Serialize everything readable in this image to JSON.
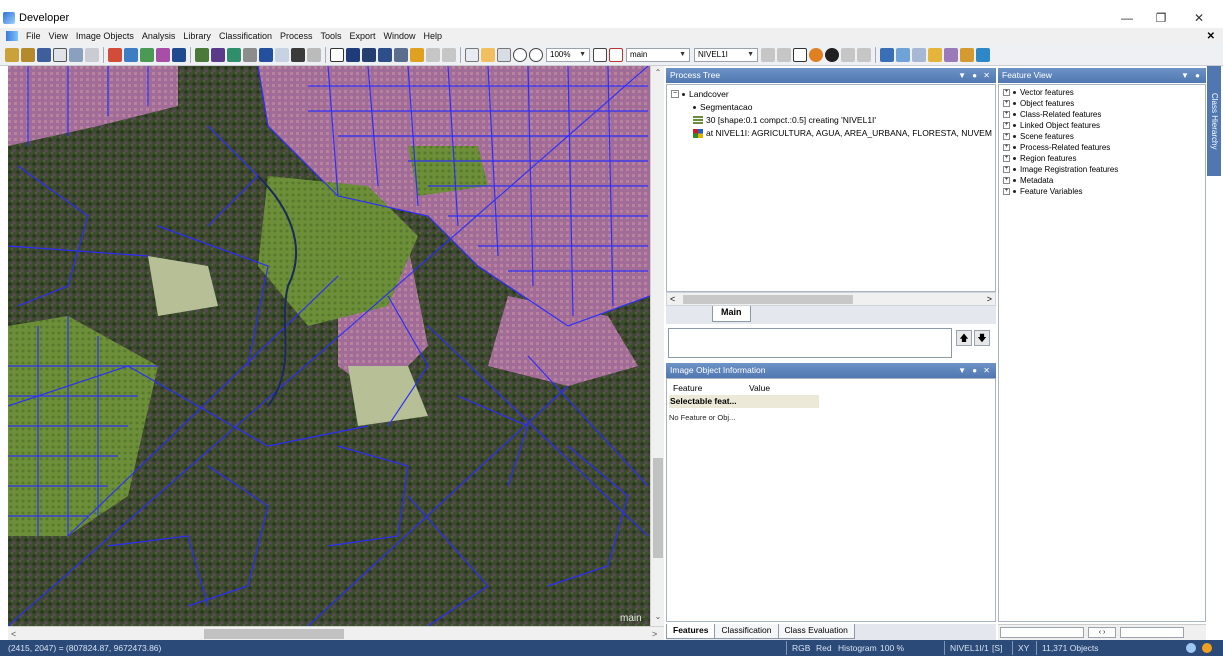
{
  "window": {
    "title": "Developer"
  },
  "menu": [
    "File",
    "View",
    "Image Objects",
    "Analysis",
    "Library",
    "Classification",
    "Process",
    "Tools",
    "Export",
    "Window",
    "Help"
  ],
  "toolbar": {
    "zoom": "100%",
    "view_combo": "main",
    "level_combo": "NIVEL1I"
  },
  "viewer": {
    "label": "main"
  },
  "process_tree": {
    "title": "Process Tree",
    "rows": [
      "Landcover",
      "Segmentacao",
      "30 [shape:0.1 compct.:0.5] creating 'NIVEL1I'",
      "at  NIVEL1I: AGRICULTURA, AGUA, AREA_URBANA, FLORESTA, NUVEM"
    ],
    "tab": "Main"
  },
  "image_object_info": {
    "title": "Image Object Information",
    "col_feature": "Feature",
    "col_value": "Value",
    "selected": "Selectable feat...",
    "empty": "No Feature or Obj..."
  },
  "bottom_tabs": [
    "Features",
    "Classification",
    "Class Evaluation"
  ],
  "feature_view": {
    "title": "Feature View",
    "items": [
      "Vector features",
      "Object features",
      "Class-Related features",
      "Linked Object features",
      "Scene features",
      "Process-Related features",
      "Region features",
      "Image Registration features",
      "Metadata",
      "Feature Variables"
    ]
  },
  "side_tab": "Class Hierarchy",
  "status": {
    "coords": "(2415, 2047) = (807824.87, 9672473.86)",
    "rgb": "RGB",
    "red": "Red",
    "histogram": "Histogram",
    "zoom": "100 %",
    "level": "NIVEL1I/1",
    "s": "[S]",
    "xy": "XY",
    "objects": "11,371 Objects"
  }
}
